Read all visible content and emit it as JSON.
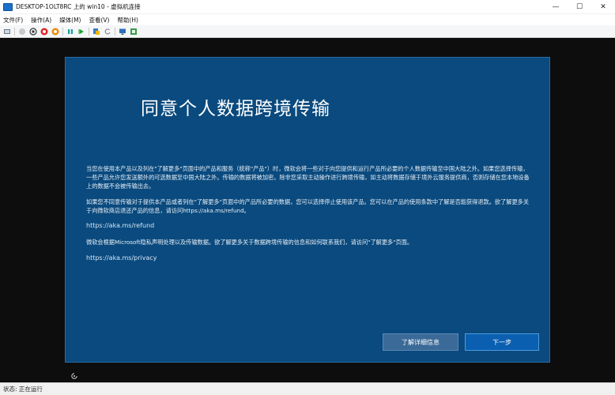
{
  "window": {
    "title": "DESKTOP-1OLT8RC 上的 win10 - 虚拟机连接",
    "minimize": "—",
    "maximize": "☐",
    "close": "✕"
  },
  "menu": {
    "items": [
      "文件(F)",
      "操作(A)",
      "媒体(M)",
      "查看(V)",
      "帮助(H)"
    ]
  },
  "oobe": {
    "title": "同意个人数据跨境传输",
    "paragraph1": "当您在使用本产品以及列在\"了解更多\"页面中的产品和服务（统称\"产品\"）时，微软会将一些对于向您提供和运行产品所必要的个人数据传输至中国大陆之外。如果您选择传输，一些产品允许您发送额外的可选数据至中国大陆之外。传输的数据将被加密。除非您采取主动操作进行跨境传输，如主动将数据存储于境外云服务提供商，否则存储在您本地设备上的数据不会被传输出去。",
    "paragraph2": "如果您不同意传输对于提供本产品或者列在\"了解更多\"页面中的产品所必要的数据，您可以选择停止使用该产品。您可以在产品的使用条款中了解是否能获得退款。欲了解更多关于向微软商店退还产品的信息，请访问https://aka.ms/refund。",
    "link1": "https://aka.ms/refund",
    "paragraph3": "微软会根据Microsoft隐私声明处理以及传输数据。欲了解更多关于数据跨境传输的信息和如何联系我们，请访问\"了解更多\"页面。",
    "link2": "https://aka.ms/privacy",
    "details_button": "了解详细信息",
    "next_button": "下一步"
  },
  "status": {
    "text": "状态: 正在运行"
  }
}
